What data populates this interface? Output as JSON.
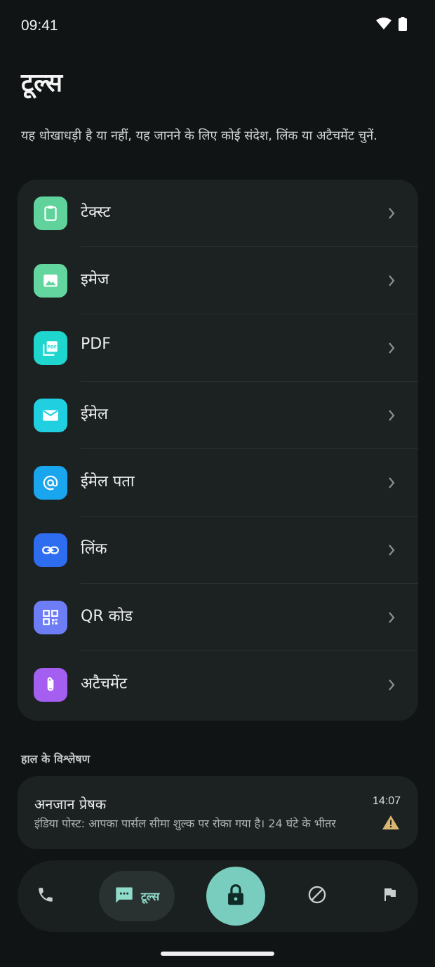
{
  "status_bar": {
    "time": "09:41",
    "icons": [
      "wifi-icon",
      "battery-icon"
    ]
  },
  "page": {
    "title": "टूल्स",
    "subtitle": "यह धोखाधड़ी है या नहीं, यह जानने के लिए कोई संदेश, लिंक या अटैचमेंट चुनें."
  },
  "tools": [
    {
      "label": "टेक्स्ट",
      "icon": "clipboard-icon",
      "color": "#5fd39b"
    },
    {
      "label": "इमेज",
      "icon": "image-icon",
      "color": "#63d6a0"
    },
    {
      "label": "PDF",
      "icon": "pdf-icon",
      "color": "#1fd6cf"
    },
    {
      "label": "ईमेल",
      "icon": "mail-icon",
      "color": "#20cfe0"
    },
    {
      "label": "ईमेल पता",
      "icon": "at-sign-icon",
      "color": "#1aa6ef"
    },
    {
      "label": "लिंक",
      "icon": "link-icon",
      "color": "#2f6df0"
    },
    {
      "label": "QR कोड",
      "icon": "qr-code-icon",
      "color": "#6d7df5"
    },
    {
      "label": "अटैचमेंट",
      "icon": "paperclip-icon",
      "color": "#a45ff0"
    }
  ],
  "recent": {
    "section_label": "हाल के विश्लेषण",
    "items": [
      {
        "sender": "अनजान प्रेषक",
        "time": "14:07",
        "preview": "इंडिया पोस्ट: आपका पार्सल सीमा शुल्क पर रोका गया है। 24 घंटे के भीतर",
        "status_icon": "warning-icon",
        "status_color": "#d9b56f"
      }
    ]
  },
  "bottom_nav": {
    "items": [
      {
        "icon": "phone-icon"
      },
      {
        "icon": "message-icon",
        "label": "टूल्स",
        "selected": true
      },
      {
        "icon": "lock-icon",
        "primary": true
      },
      {
        "icon": "block-icon"
      },
      {
        "icon": "flag-icon"
      }
    ],
    "accent": "#78cdbf"
  }
}
